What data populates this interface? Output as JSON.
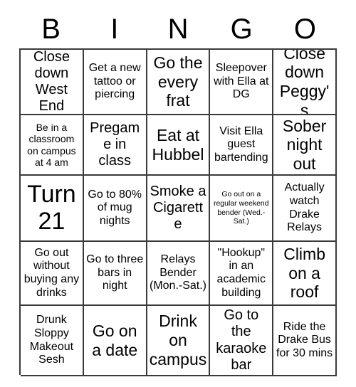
{
  "card": {
    "title_letters": [
      "B",
      "I",
      "N",
      "G",
      "O"
    ],
    "rows": [
      [
        {
          "text": "Close down West End",
          "size": "l"
        },
        {
          "text": "Get a new tattoo or piercing",
          "size": "m"
        },
        {
          "text": "Go the every frat",
          "size": "xl"
        },
        {
          "text": "Sleepover with Ella at DG",
          "size": "m"
        },
        {
          "text": "Close down Peggy's",
          "size": "xl"
        }
      ],
      [
        {
          "text": "Be in a classroom on campus at 4 am",
          "size": "s"
        },
        {
          "text": "Pregame in class",
          "size": "l"
        },
        {
          "text": "Eat at Hubbel",
          "size": "xl"
        },
        {
          "text": "Visit Ella guest bartending",
          "size": "m"
        },
        {
          "text": "Sober night out",
          "size": "xl"
        }
      ],
      [
        {
          "text": "Turn 21",
          "size": "xxl"
        },
        {
          "text": "Go to 80% of mug nights",
          "size": "m"
        },
        {
          "text": "Smoke a Cigarette",
          "size": "l"
        },
        {
          "text": "Go out on a regular weekend bender (Wed.-Sat.)",
          "size": "xs"
        },
        {
          "text": "Actually watch Drake Relays",
          "size": "m"
        }
      ],
      [
        {
          "text": "Go out without buying any drinks",
          "size": "m"
        },
        {
          "text": "Go to three bars in night",
          "size": "m"
        },
        {
          "text": "Relays Bender (Mon.-Sat.)",
          "size": "m"
        },
        {
          "text": "\"Hookup\" in an academic building",
          "size": "m"
        },
        {
          "text": "Climb on a roof",
          "size": "xl"
        }
      ],
      [
        {
          "text": "Drunk Sloppy Makeout Sesh",
          "size": "m"
        },
        {
          "text": "Go on a date",
          "size": "xl"
        },
        {
          "text": "Drink on campus",
          "size": "xl"
        },
        {
          "text": "Go to the karaoke bar",
          "size": "l"
        },
        {
          "text": "Ride the Drake Bus for 30 mins",
          "size": "m"
        }
      ]
    ]
  },
  "colors": {
    "grid_line": "#3a3a3a",
    "text": "#000000",
    "background": "#ffffff"
  }
}
